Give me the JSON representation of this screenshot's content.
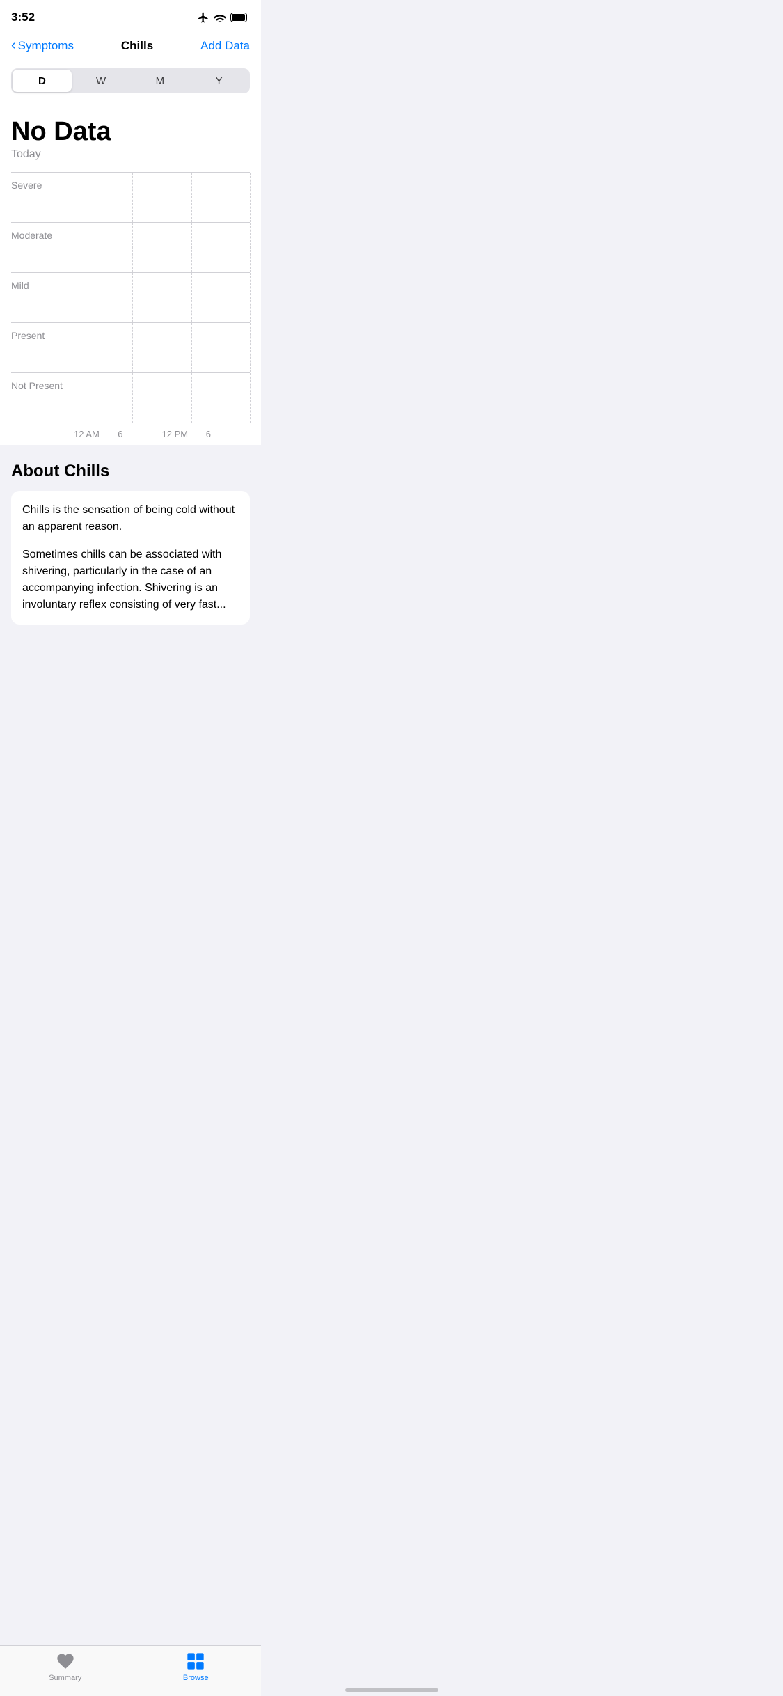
{
  "status": {
    "time": "3:52"
  },
  "nav": {
    "back_label": "Symptoms",
    "title": "Chills",
    "action_label": "Add Data"
  },
  "segment_control": {
    "items": [
      "D",
      "W",
      "M",
      "Y"
    ],
    "active_index": 0
  },
  "chart": {
    "no_data_label": "No Data",
    "period_label": "Today",
    "rows": [
      {
        "label": "Severe"
      },
      {
        "label": "Moderate"
      },
      {
        "label": "Mild"
      },
      {
        "label": "Present"
      },
      {
        "label": "Not Present"
      }
    ],
    "time_labels": [
      "12 AM",
      "6",
      "12 PM",
      "6"
    ]
  },
  "about": {
    "title": "About Chills",
    "paragraphs": [
      "Chills is the sensation of being cold without an apparent reason.",
      "Sometimes chills can be associated with shivering, particularly in the case of an accompanying infection. Shivering is an involuntary reflex consisting of very fast..."
    ]
  },
  "tab_bar": {
    "items": [
      {
        "label": "Summary",
        "active": false
      },
      {
        "label": "Browse",
        "active": true
      }
    ]
  }
}
